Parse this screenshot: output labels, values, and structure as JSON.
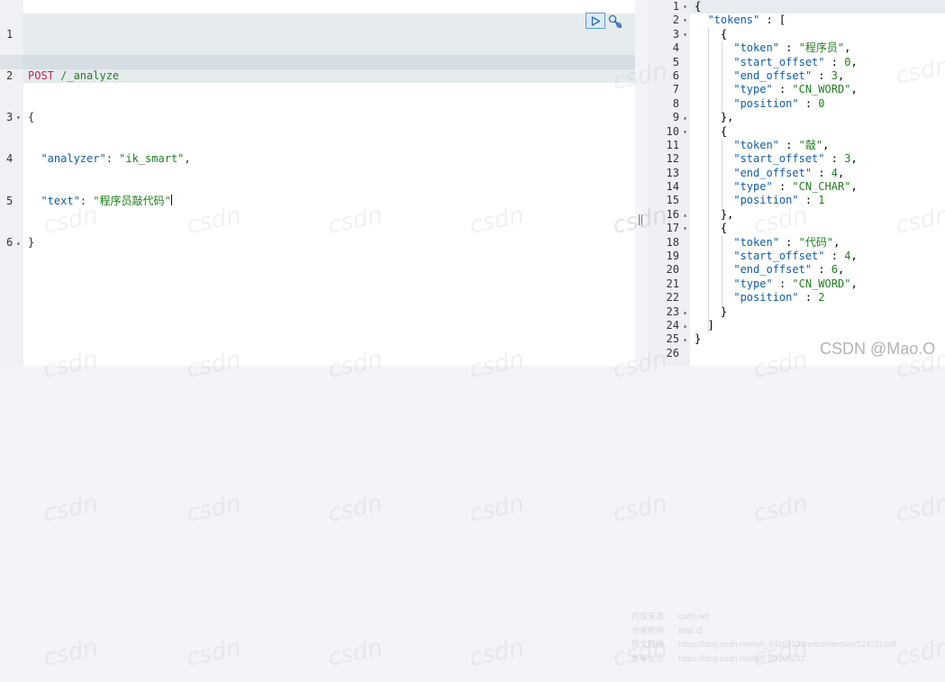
{
  "request_editor": {
    "gutter_numbers": [
      "1",
      "2",
      "3",
      "4",
      "5",
      "6"
    ],
    "method": "POST",
    "url": " /_analyze",
    "open_brace": "{",
    "close_brace": "}",
    "analyzer_key": "\"analyzer\"",
    "analyzer_colon": ": ",
    "analyzer_value": "\"ik_smart\"",
    "analyzer_comma": ",",
    "text_key": "\"text\"",
    "text_colon": ": ",
    "text_value": "\"程序员敲代码\""
  },
  "response_viewer": {
    "gutter_numbers": [
      "1",
      "2",
      "3",
      "4",
      "5",
      "6",
      "7",
      "8",
      "9",
      "10",
      "11",
      "12",
      "13",
      "14",
      "15",
      "16",
      "17",
      "18",
      "19",
      "20",
      "21",
      "22",
      "23",
      "24",
      "25",
      "26"
    ],
    "lines": [
      "{",
      "  \"tokens\" : [",
      "    {",
      "      \"token\" : \"程序员\",",
      "      \"start_offset\" : 0,",
      "      \"end_offset\" : 3,",
      "      \"type\" : \"CN_WORD\",",
      "      \"position\" : 0",
      "    },",
      "    {",
      "      \"token\" : \"敲\",",
      "      \"start_offset\" : 3,",
      "      \"end_offset\" : 4,",
      "      \"type\" : \"CN_CHAR\",",
      "      \"position\" : 1",
      "    },",
      "    {",
      "      \"token\" : \"代码\",",
      "      \"start_offset\" : 4,",
      "      \"end_offset\" : 6,",
      "      \"type\" : \"CN_WORD\",",
      "      \"position\" : 2",
      "    }",
      "  ]",
      "}",
      ""
    ]
  },
  "icons": {
    "run": "play-triangle-icon",
    "settings": "wrench-icon",
    "fold_open": "fold-down-icon",
    "fold_close": "fold-up-icon"
  },
  "watermark": {
    "tile_text": "csdn",
    "brand": "CSDN @Mao.O",
    "meta": [
      {
        "key": "内容来源",
        "value": "csdn.net"
      },
      {
        "key": "作者昵称",
        "value": "Mao.O"
      },
      {
        "key": "原文链接",
        "value": "https://blog.csdn.net/m0_60155232/article/details/124211648"
      },
      {
        "key": "作者主页",
        "value": "https://blog.csdn.net/m0_60155232"
      }
    ]
  },
  "colors": {
    "method": "#c7254e",
    "url": "#2a7a2a",
    "property": "#0f5ca8",
    "string": "#1e7e1e",
    "run_button_border": "#5b9ad4"
  }
}
